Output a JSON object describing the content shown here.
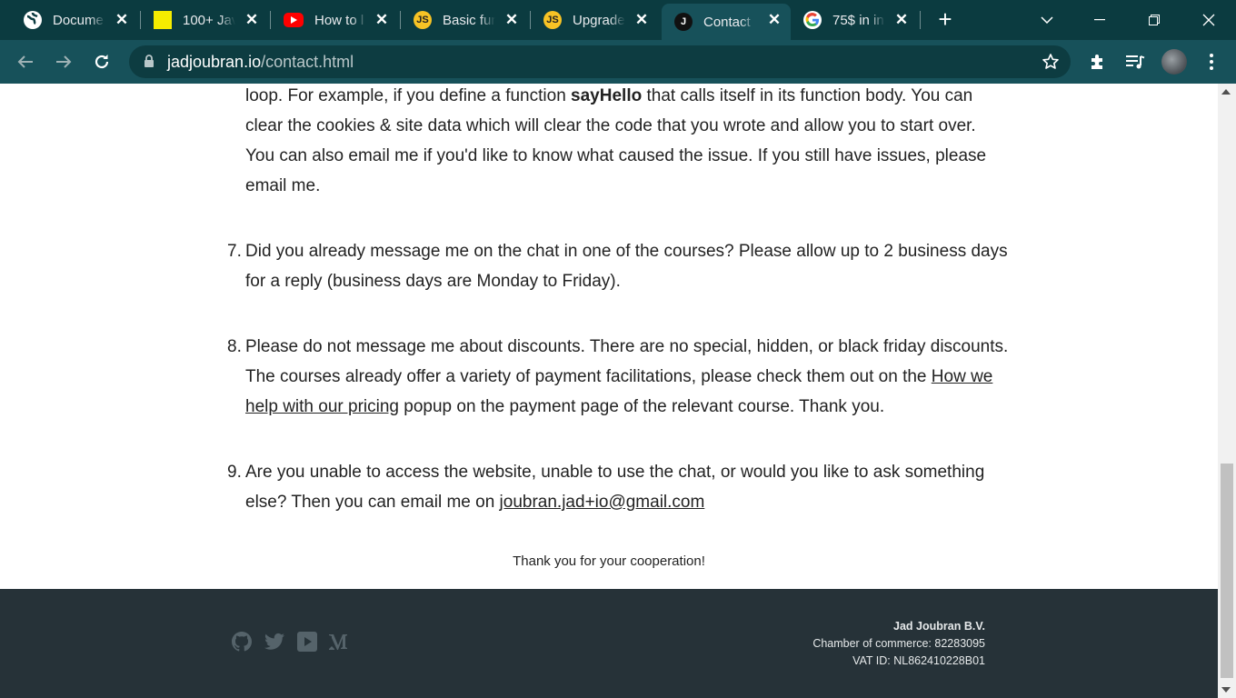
{
  "browser": {
    "tabs": [
      {
        "title": "Docume",
        "favicon": "globe-icon",
        "active": false
      },
      {
        "title": "100+ Jav",
        "favicon": "yellow-square-icon",
        "active": false
      },
      {
        "title": "How to l",
        "favicon": "youtube-icon",
        "active": false
      },
      {
        "title": "Basic fun",
        "favicon": "js-icon",
        "active": false
      },
      {
        "title": "Upgrade",
        "favicon": "js-icon",
        "active": false
      },
      {
        "title": "Contact",
        "favicon": "j-icon",
        "active": true
      },
      {
        "title": "75$ in in",
        "favicon": "google-icon",
        "active": false
      }
    ],
    "url_host": "jadjoubran.io",
    "url_path": "/contact.html"
  },
  "content": {
    "intro_part1": "loop. For example, if you define a function ",
    "intro_bold": "sayHello",
    "intro_part2": " that calls itself in its function body. You can clear the cookies & site data which will clear the code that you wrote and allow you to start over. You can also email me if you'd like to know what caused the issue. If you still have issues, please email me.",
    "items": [
      {
        "number": "7.",
        "text": "Did you already message me on the chat in one of the courses? Please allow up to 2 business days for a reply (business days are Monday to Friday)."
      },
      {
        "number": "8.",
        "text_before": "Please do not message me about discounts. There are no special, hidden, or black friday discounts. The courses already offer a variety of payment facilitations, please check them out on the ",
        "link": "How we help with our pricing",
        "text_after": " popup on the payment page of the relevant course. Thank you."
      },
      {
        "number": "9.",
        "text_before": "Are you unable to access the website, unable to use the chat, or would you like to ask something else? Then you can email me on ",
        "email": "joubran.jad+io@gmail.com"
      }
    ],
    "thanks": "Thank you for your cooperation!"
  },
  "footer": {
    "social": [
      "github-icon",
      "twitter-icon",
      "youtube-icon",
      "medium-icon"
    ],
    "company_name": "Jad Joubran B.V.",
    "chamber": "Chamber of commerce: 82283095",
    "vat": "VAT ID: NL862410228B01"
  },
  "colors": {
    "tabstrip": "#0b3b40",
    "toolbar": "#17515a",
    "footer": "#263238",
    "text": "#222222"
  }
}
